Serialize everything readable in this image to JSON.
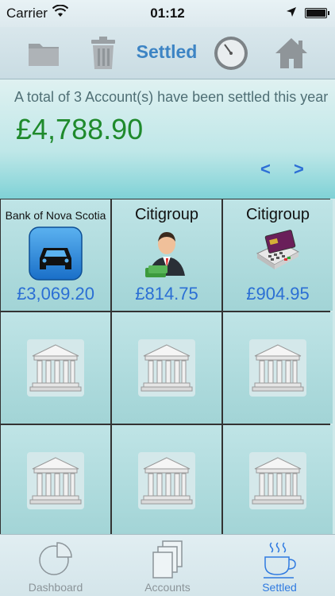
{
  "status": {
    "carrier": "Carrier",
    "time": "01:12"
  },
  "toolbar": {
    "title": "Settled",
    "icons": [
      "folder-icon",
      "trash-icon",
      "clock-icon",
      "home-icon"
    ]
  },
  "summary": {
    "caption": "A total of 3 Account(s) have been settled this year",
    "total": "£4,788.90",
    "prev": "<",
    "next": ">"
  },
  "accounts": [
    {
      "name": "Bank of Nova Scotia",
      "amount": "£3,069.20",
      "icon": "car-icon"
    },
    {
      "name": "Citigroup",
      "amount": "£814.75",
      "icon": "businessman-icon"
    },
    {
      "name": "Citigroup",
      "amount": "£904.95",
      "icon": "card-terminal-icon"
    }
  ],
  "tabs": [
    {
      "label": "Dashboard",
      "icon": "pie-chart-icon"
    },
    {
      "label": "Accounts",
      "icon": "documents-icon"
    },
    {
      "label": "Settled",
      "icon": "coffee-cup-icon",
      "active": true
    }
  ],
  "colors": {
    "accent": "#3d84c4",
    "total": "#1f8a2c",
    "amount": "#2b6fd4"
  }
}
